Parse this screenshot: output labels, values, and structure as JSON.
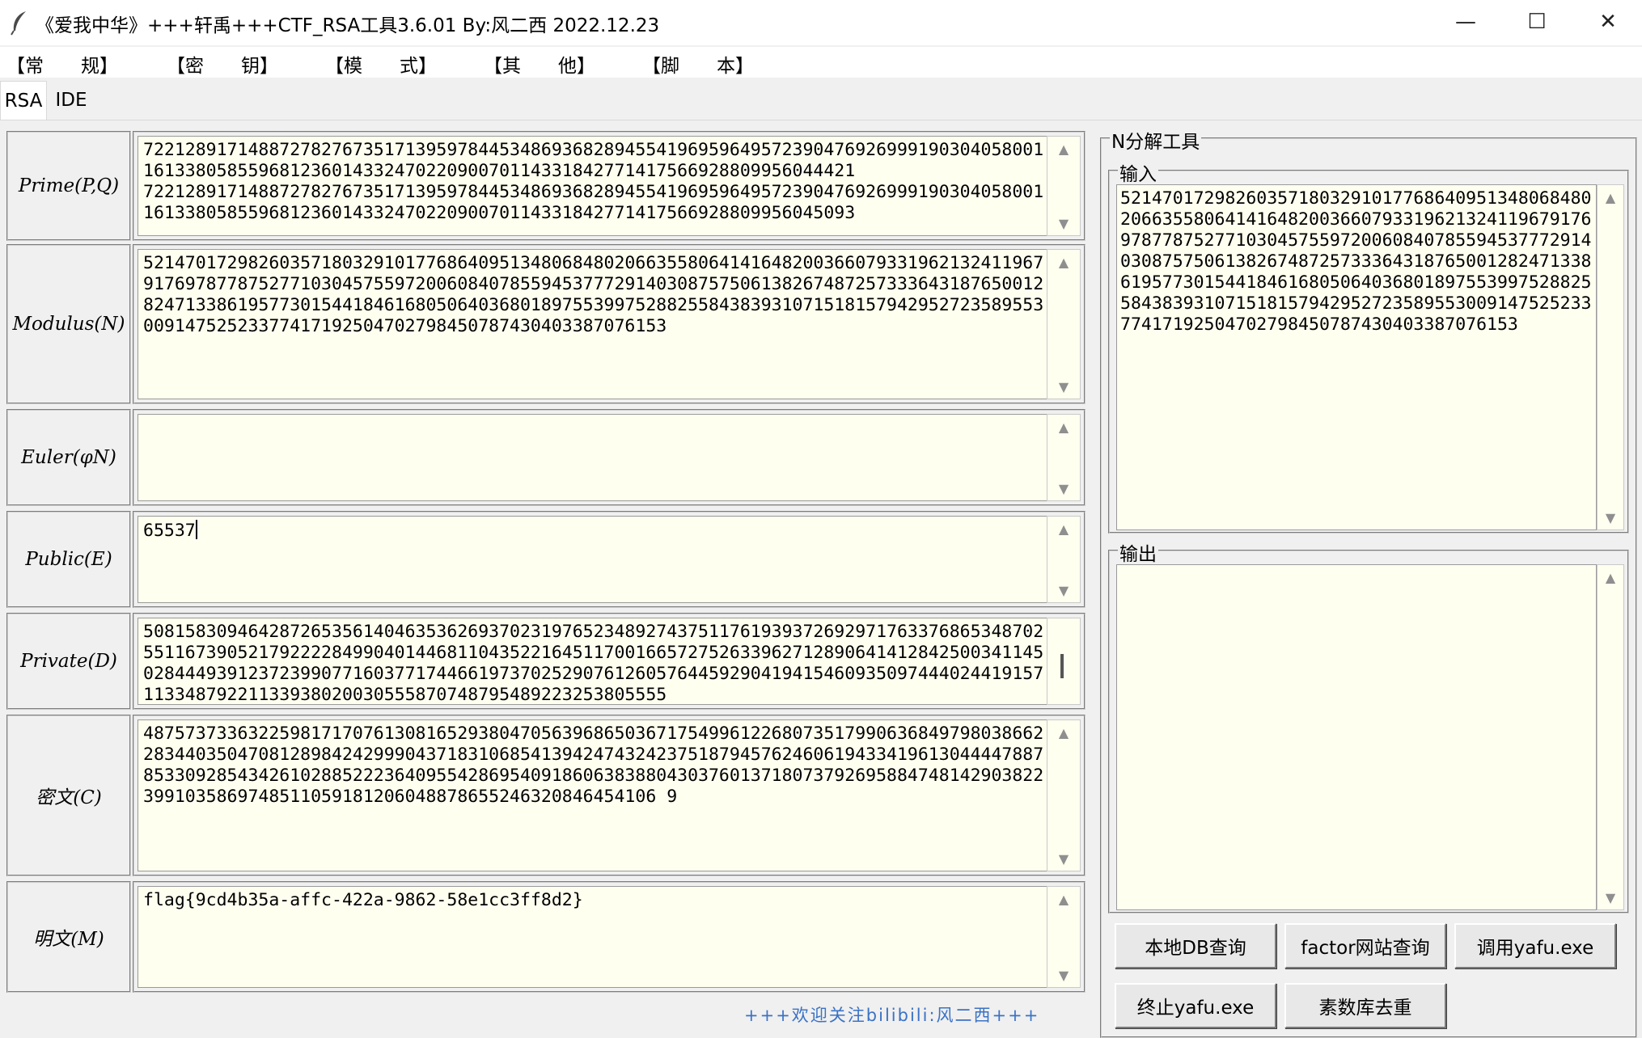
{
  "window": {
    "title": "《爱我中华》+++轩禹+++CTF_RSA工具3.6.01   By:风二西 2022.12.23",
    "minimize_glyph": "—",
    "maximize_glyph": "☐",
    "close_glyph": "✕"
  },
  "menu": [
    {
      "id": "general",
      "label": "【常　　规】"
    },
    {
      "id": "key",
      "label": "【密　　钥】"
    },
    {
      "id": "mode",
      "label": "【模　　式】"
    },
    {
      "id": "other",
      "label": "【其　　他】"
    },
    {
      "id": "script",
      "label": "【脚　　本】"
    }
  ],
  "tabs": [
    "RSA",
    "IDE"
  ],
  "fields": {
    "prime": {
      "label": "Prime(P,Q)",
      "value": "7221289171488727827673517139597844534869368289455419695964957239047692699919030405800116133805855968123601433247022090070114331842771417566928809956044421\n7221289171488727827673517139597844534869368289455419695964957239047692699919030405800116133805855968123601433247022090070114331842771417566928809956045093"
    },
    "modulus": {
      "label": "Modulus(N)",
      "value": "52147017298260357180329101776864095134806848020663558064141648200366079331962132411967917697877875277103045755972006084078559453777291403087575061382674872573336431876500128247133861957730154418461680506403680189755399752882558438393107151815794295272358955300914752523377417192504702798450787430403387076153"
    },
    "euler": {
      "label": "Euler(φN)",
      "value": ""
    },
    "public": {
      "label": "Public(E)",
      "value": "65537"
    },
    "private": {
      "label": "Private(D)",
      "value": "50815830946428726535614046353626937023197652348927437511761939372692971763376865348702551167390521792222849904014468110435221645117001665727526339627128906414128425003411450284449391237239907716037717446619737025290761260576445929041941546093509744402441915711334879221133938020030555870748795489223253805555"
    },
    "cipher": {
      "label": "密文(C)",
      "value": "4875737336322598171707613081652938047056396865036717549961226807351799063684979803866228344035047081289842429990437183106854139424743242375187945762460619433419613044447887853309285434261028852223640955428695409186063838804303760137180737926958847481429038223991035869748511059181206048878655246320846454106 9"
    },
    "plain": {
      "label": "明文(M)",
      "value": "flag{9cd4b35a-affc-422a-9862-58e1cc3ff8d2}"
    }
  },
  "footer": "+++欢迎关注bilibili:风二西+++",
  "factor_tool": {
    "title": "N分解工具",
    "input_label": "输入",
    "input_value": "52147017298260357180329101776864095134806848020663558064141648200366079331962132411967917697877875277103045755972006084078559453777291403087575061382674872573336431876500128247133861957730154418461680506403680189755399752882558438393107151815794295272358955300914752523377417192504702798450787430403387076153",
    "output_label": "输出",
    "output_value": "",
    "buttons": {
      "local_db": "本地DB查询",
      "factor_site": "factor网站查询",
      "call_yafu": "调用yafu.exe",
      "stop_yafu": "终止yafu.exe",
      "dedupe": "素数库去重"
    }
  }
}
